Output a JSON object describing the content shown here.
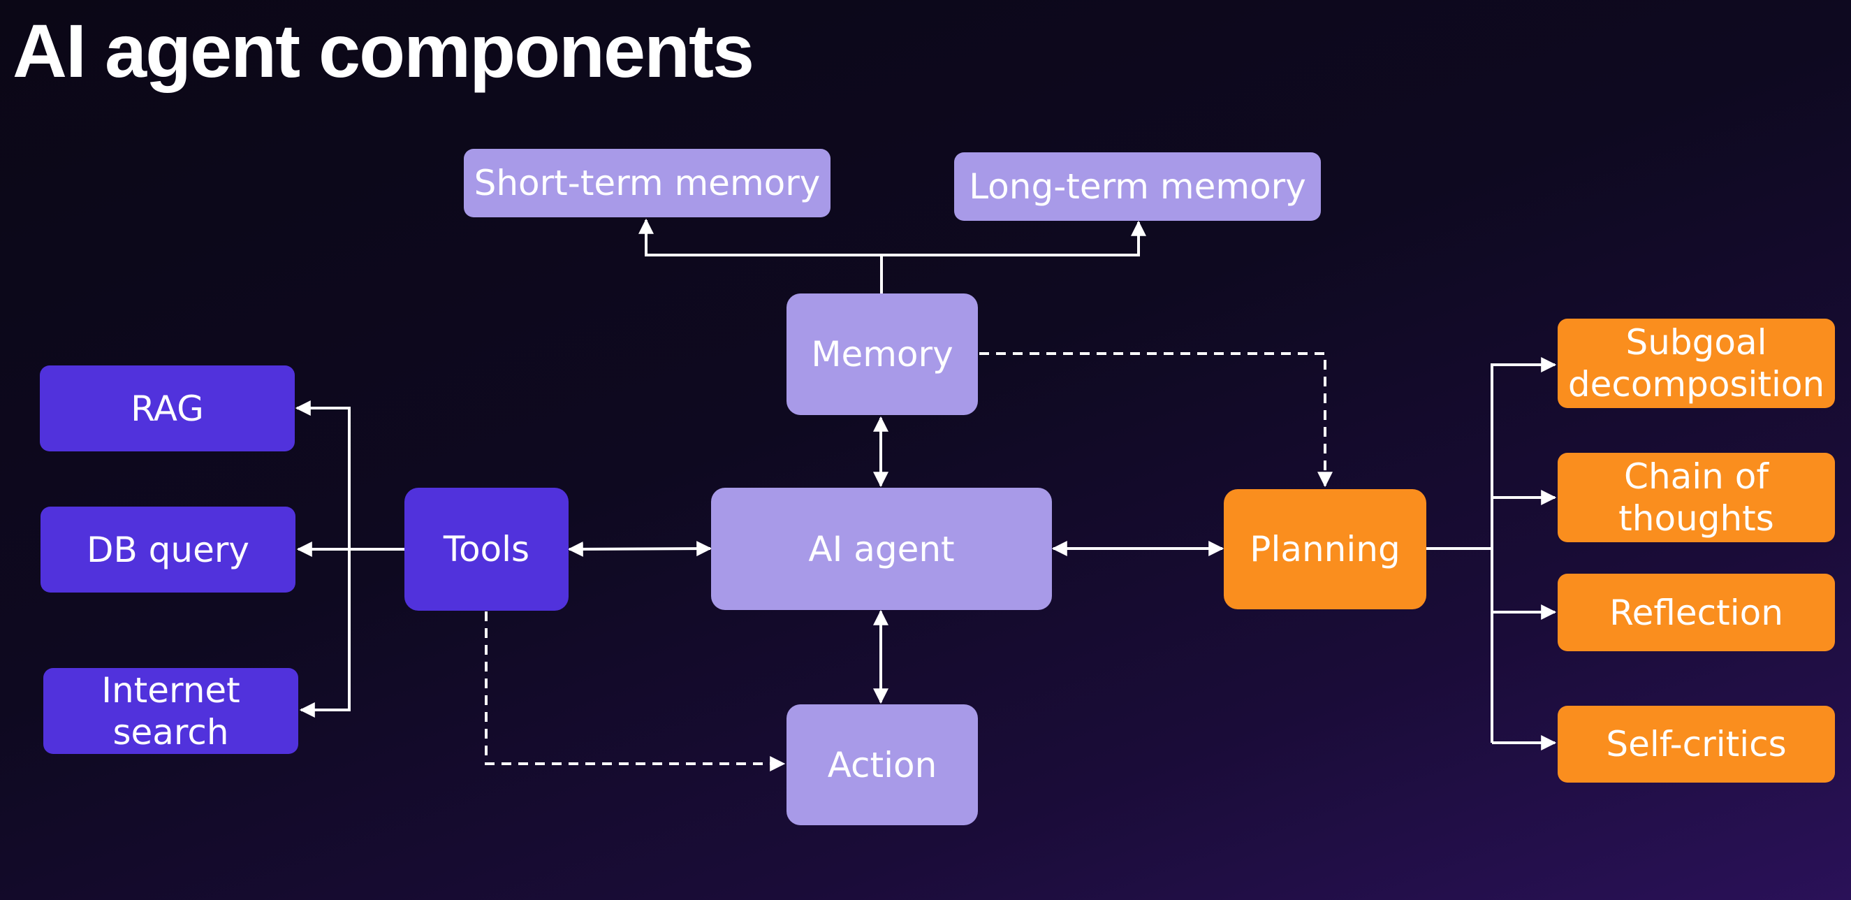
{
  "title": "AI agent components",
  "colors": {
    "background": "#0e0920",
    "core_node": "#a89ae8",
    "tool_node": "#5132dc",
    "planning_node": "#fa8e1e",
    "connector": "#ffffff"
  },
  "nodes": {
    "short_term_memory": "Short-term memory",
    "long_term_memory": "Long-term memory",
    "memory": "Memory",
    "ai_agent": "AI agent",
    "tools": "Tools",
    "planning": "Planning",
    "action": "Action",
    "rag": "RAG",
    "db_query": "DB query",
    "internet_search": "Internet\nsearch",
    "subgoal_decomposition": "Subgoal\ndecomposition",
    "chain_of_thoughts": "Chain of\nthoughts",
    "reflection": "Reflection",
    "self_critics": "Self-critics"
  },
  "edges": [
    {
      "from": "memory",
      "to": "short_term_memory",
      "style": "solid",
      "arrow": "end"
    },
    {
      "from": "memory",
      "to": "long_term_memory",
      "style": "solid",
      "arrow": "end"
    },
    {
      "from": "memory",
      "to": "planning",
      "style": "dashed",
      "arrow": "end"
    },
    {
      "from": "ai_agent",
      "to": "memory",
      "style": "solid",
      "arrow": "both"
    },
    {
      "from": "ai_agent",
      "to": "tools",
      "style": "solid",
      "arrow": "both"
    },
    {
      "from": "ai_agent",
      "to": "planning",
      "style": "solid",
      "arrow": "both"
    },
    {
      "from": "ai_agent",
      "to": "action",
      "style": "solid",
      "arrow": "both"
    },
    {
      "from": "tools",
      "to": "action",
      "style": "dashed",
      "arrow": "end"
    },
    {
      "from": "tools",
      "to": "rag",
      "style": "solid",
      "arrow": "end"
    },
    {
      "from": "tools",
      "to": "db_query",
      "style": "solid",
      "arrow": "end"
    },
    {
      "from": "tools",
      "to": "internet_search",
      "style": "solid",
      "arrow": "end"
    },
    {
      "from": "planning",
      "to": "subgoal_decomposition",
      "style": "solid",
      "arrow": "end"
    },
    {
      "from": "planning",
      "to": "chain_of_thoughts",
      "style": "solid",
      "arrow": "end"
    },
    {
      "from": "planning",
      "to": "reflection",
      "style": "solid",
      "arrow": "end"
    },
    {
      "from": "planning",
      "to": "self_critics",
      "style": "solid",
      "arrow": "end"
    }
  ]
}
